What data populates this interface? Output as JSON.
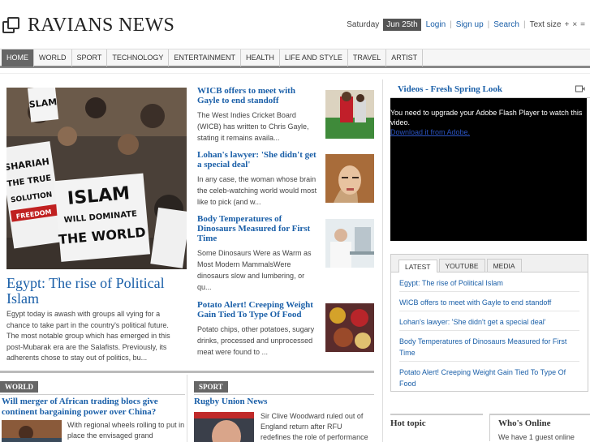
{
  "site": {
    "name": "RAVIANS NEWS"
  },
  "topbar": {
    "day": "Saturday",
    "date": "Jun 25th",
    "login": "Login",
    "signup": "Sign up",
    "search": "Search",
    "text_size": "Text size",
    "plus": "+",
    "minus": "×",
    "reset": "="
  },
  "nav": [
    "HOME",
    "WORLD",
    "SPORT",
    "TECHNOLOGY",
    "ENTERTAINMENT",
    "HEALTH",
    "LIFE AND STYLE",
    "TRAVEL",
    "ARTIST"
  ],
  "hero": {
    "title": "Egypt: The rise of Political Islam",
    "text": "Egypt today is awash with groups all vying for a chance to take part in the country's political future. The most notable group which has emerged in this post-Mubarak era are the Salafists.  Previously, its adherents chose to stay out of politics, bu..."
  },
  "stories": [
    {
      "title": "WICB offers to meet with Gayle to end standoff",
      "text": "The West Indies Cricket Board (WICB) has written to Chris Gayle, stating it remains availa..."
    },
    {
      "title": "Lohan's lawyer: 'She didn't get a special deal'",
      "text": "In any case, the woman whose brain the celeb-watching world would most like to pick (and w..."
    },
    {
      "title": "Body Temperatures of Dinosaurs Measured for First Time",
      "text": "Some Dinosaurs Were as Warm as Most Modern MammalsWere dinosaurs slow and lumbering, or qu..."
    },
    {
      "title": "Potato Alert! Creeping Weight Gain Tied To Type Of Food",
      "text": "Potato chips, other potatoes, sugary drinks, processed and unprocessed meat were found to ..."
    }
  ],
  "sections": {
    "world": {
      "tag": "WORLD",
      "title": "Will merger of African trading blocs give continent bargaining power over China?",
      "text": "With regional wheels rolling to put in place the envisaged grand"
    },
    "sport": {
      "tag": "SPORT",
      "title": "Rugby Union News",
      "text": "Sir Clive Woodward ruled out of England return after RFU redefines the role of performance"
    }
  },
  "video": {
    "title": "Videos - Fresh Spring Look",
    "message": "You need to upgrade your Adobe Flash Player to watch this video.",
    "link": "Download it from Adobe."
  },
  "tabs": {
    "labels": [
      "LATEST",
      "YOUTUBE",
      "MEDIA"
    ],
    "items": [
      "Egypt: The rise of Political Islam",
      "WICB offers to meet with Gayle to end standoff",
      "Lohan's lawyer: 'She didn't get a special deal'",
      "Body Temperatures of Dinosaurs Measured for First Time",
      "Potato Alert! Creeping Weight Gain Tied To Type Of Food"
    ]
  },
  "hot_topic": {
    "title": "Hot topic"
  },
  "whos_online": {
    "title": "Who's Online",
    "text": "We have 1 guest online"
  },
  "photo_signs": [
    "ISLAM",
    "WILL DOMINATE",
    "THE WORLD",
    "SHARIAH",
    "THE TRUE",
    "SOLUTION",
    "FREEDOM",
    "SLAM"
  ]
}
